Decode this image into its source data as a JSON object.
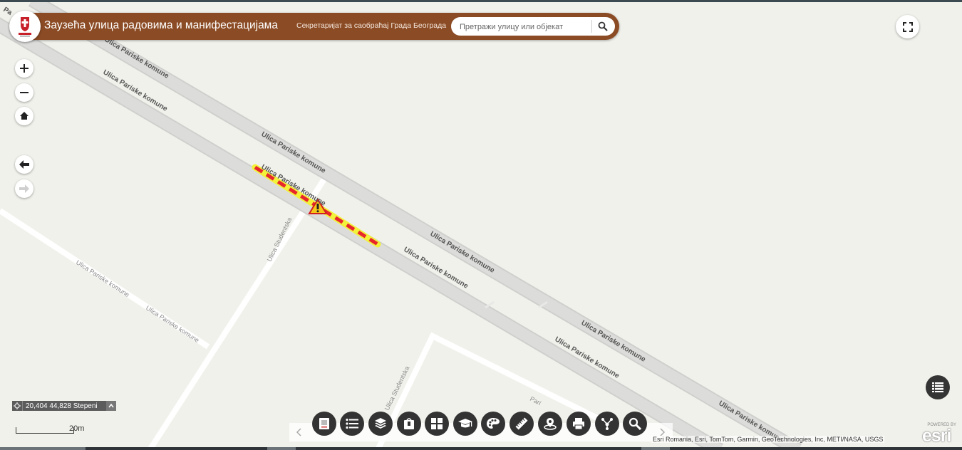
{
  "header": {
    "title": "Заузећа улица радовима и манифестацијама",
    "subtitle": "Секретаријат за саобраћај Града Београда"
  },
  "search": {
    "placeholder": "Претражи улицу или објекат",
    "icon": "search-icon"
  },
  "map": {
    "street_labels": {
      "pariske_komune": "Ulica Pariske komune",
      "studentska": "Ulica Studentska",
      "partial_pa": "Pa",
      "partial_pari": "Pari"
    },
    "closure_color": "#e8262b",
    "closure_halo_color": "#f2f23a",
    "warning_icon": "roadworks-warning-icon"
  },
  "status": {
    "coordinates": "20,404 44,828 Stepeni",
    "scale_label": "20m"
  },
  "attribution": "Esri Romania, Esri, TomTom, Garmin, GeoTechnologies, Inc, METI/NASA, USGS",
  "branding": {
    "powered_by": "POWERED BY",
    "esri": "esri"
  },
  "colors": {
    "banner": "#8b4b24",
    "tool_button": "#333333"
  }
}
